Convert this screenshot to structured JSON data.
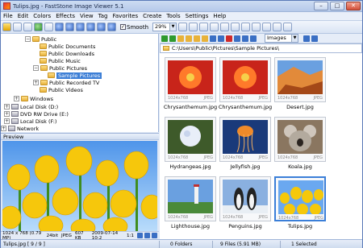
{
  "window": {
    "title": "Tulips.jpg - FastStone Image Viewer 5.1"
  },
  "window_buttons": {
    "minimize": "–",
    "maximize": "□",
    "close": "✕"
  },
  "menu": [
    "File",
    "Edit",
    "Colors",
    "Effects",
    "View",
    "Tag",
    "Favorites",
    "Create",
    "Tools",
    "Settings",
    "Help"
  ],
  "toolbar": {
    "smooth_label": "Smooth",
    "smooth_checked": "✓",
    "zoom_value": "29%",
    "view_mode": "Images"
  },
  "tree": {
    "items": [
      {
        "label": "Public"
      },
      {
        "label": "Public Documents"
      },
      {
        "label": "Public Downloads"
      },
      {
        "label": "Public Music"
      },
      {
        "label": "Public Pictures"
      },
      {
        "label": "Sample Pictures"
      },
      {
        "label": "Public Recorded TV"
      },
      {
        "label": "Public Videos"
      },
      {
        "label": "Windows"
      },
      {
        "label": "Local Disk (D:)"
      },
      {
        "label": "DVD RW Drive (E:)"
      },
      {
        "label": "Local Disk (F:)"
      },
      {
        "label": "Network"
      }
    ]
  },
  "preview": {
    "header": "Preview",
    "info_dims": "1024 x 768 (0.79 MP)",
    "info_bits": "24bit",
    "info_type": "JPEG",
    "info_size": "607 KB",
    "info_date": "2009-07-14 10:2",
    "info_ratio": "1:1"
  },
  "address": {
    "path": "C:\\Users\\Public\\Pictures\\Sample Pictures\\"
  },
  "thumbnails": [
    {
      "name": "Chrysanthemum.jpg",
      "dims": "1024x768",
      "type": "JPEG",
      "bg": "#c8241a",
      "fg": "#ff7a2a"
    },
    {
      "name": "Chrysanthemum.jpg",
      "dims": "1024x768",
      "type": "JPEG",
      "bg": "#c8241a",
      "fg": "#ff7a2a"
    },
    {
      "name": "Desert.jpg",
      "dims": "1024x768",
      "type": "JPEG",
      "bg": "#e28a3a",
      "fg": "#a44818"
    },
    {
      "name": "Hydrangeas.jpg",
      "dims": "1024x768",
      "type": "JPEG",
      "bg": "#3e5a2a",
      "fg": "#e8eef8"
    },
    {
      "name": "Jellyfish.jpg",
      "dims": "1024x768",
      "type": "JPEG",
      "bg": "#1a3a7a",
      "fg": "#f08a2a"
    },
    {
      "name": "Koala.jpg",
      "dims": "1024x768",
      "type": "JPEG",
      "bg": "#8a7660",
      "fg": "#cfc6bc"
    },
    {
      "name": "Lighthouse.jpg",
      "dims": "1024x768",
      "type": "JPEG",
      "bg": "#6aa0e0",
      "fg": "#4a8a3a"
    },
    {
      "name": "Penguins.jpg",
      "dims": "1024x768",
      "type": "JPEG",
      "bg": "#8ab0e0",
      "fg": "#222222"
    },
    {
      "name": "Tulips.jpg",
      "dims": "1024x768",
      "type": "JPEG",
      "bg": "#6aa8f0",
      "fg": "#f5c80a"
    }
  ],
  "status": {
    "file": "Tulips.jpg [ 9 / 9 ]",
    "folders": "0 Folders",
    "files": "9 Files (5.91 MB)",
    "selected": "1 Selected"
  }
}
